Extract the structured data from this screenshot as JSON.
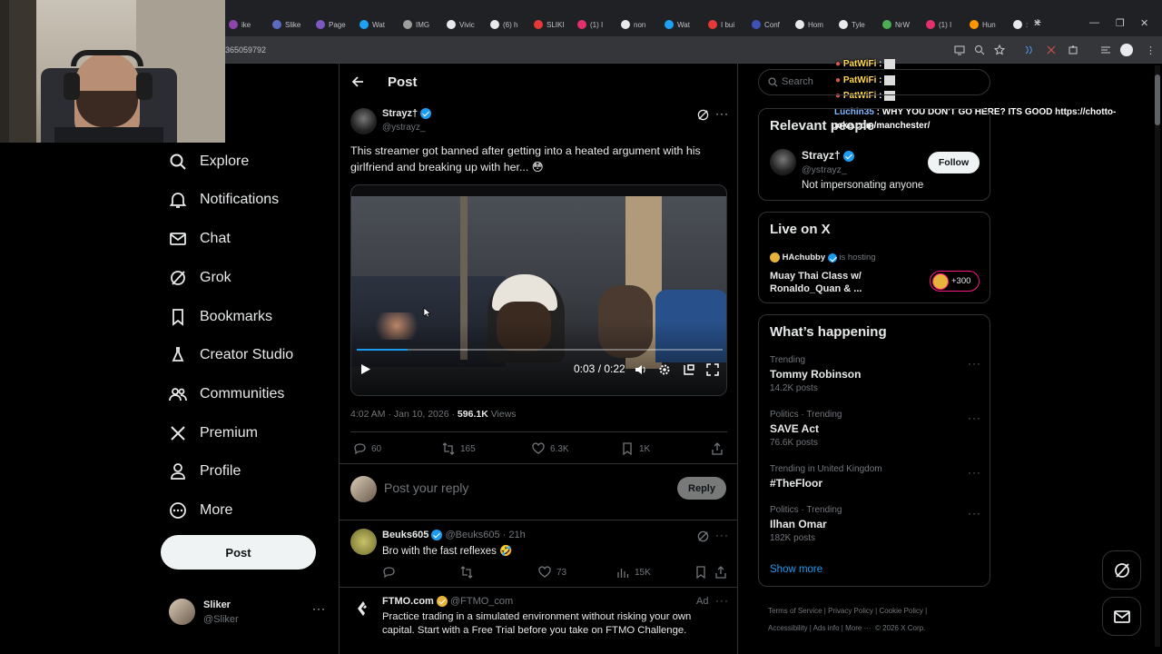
{
  "browser": {
    "tabs": [
      "ike",
      "Slike",
      "Page",
      "Wat",
      "IMG",
      "Vivic",
      "(6) h",
      "SLIKI",
      "(1) I",
      "non",
      "Wat",
      "I bui",
      "Conf",
      "Hom",
      "Tyle",
      "NrW",
      "(1) I",
      "Hun",
      ":"
    ],
    "url": "365059792"
  },
  "nav": {
    "items": [
      {
        "label": "me",
        "icon": "home-icon"
      },
      {
        "label": "Explore",
        "icon": "search-icon"
      },
      {
        "label": "Notifications",
        "icon": "bell-icon"
      },
      {
        "label": "Chat",
        "icon": "mail-icon"
      },
      {
        "label": "Grok",
        "icon": "grok-icon"
      },
      {
        "label": "Bookmarks",
        "icon": "bookmark-icon"
      },
      {
        "label": "Creator Studio",
        "icon": "flask-icon"
      },
      {
        "label": "Communities",
        "icon": "people-icon"
      },
      {
        "label": "Premium",
        "icon": "x-logo-icon"
      },
      {
        "label": "Profile",
        "icon": "person-icon"
      },
      {
        "label": "More",
        "icon": "more-circle-icon"
      }
    ],
    "post_button": "Post",
    "account": {
      "name": "Sliker",
      "handle": "@Sliker"
    }
  },
  "header": {
    "title": "Post"
  },
  "post": {
    "author": "Strayz†",
    "handle": "@ystrayz_",
    "text": "This streamer got banned after getting into a heated argument with his girlfriend and breaking up with her... 😳",
    "video_time": "0:03 / 0:22",
    "video_progress": 0.14,
    "timestamp": "4:02 AM · Jan 10, 2026 ·",
    "views_count": "596.1K",
    "views_label": "Views",
    "replies": "60",
    "reposts": "165",
    "likes": "6.3K",
    "bookmarks": "1K"
  },
  "reply_box": {
    "placeholder": "Post your reply",
    "button": "Reply"
  },
  "replies": [
    {
      "name": "Beuks605",
      "handle": "@Beuks605 · 21h",
      "text": "Bro with the fast reflexes 🤣",
      "likes": "73",
      "views": "15K"
    }
  ],
  "ad": {
    "name": "FTMO.com",
    "handle": "@FTMO_com",
    "label": "Ad",
    "text": "Practice trading in a simulated environment without risking your own capital. Start with a Free Trial before you take on FTMO Challenge."
  },
  "sidebar": {
    "search_placeholder": "Search",
    "relevant": {
      "title": "Relevant people",
      "name": "Strayz†",
      "handle": "@ystrayz_",
      "bio": "Not impersonating anyone",
      "follow": "Follow"
    },
    "live": {
      "title": "Live on X",
      "host": "HAchubby",
      "hosting": "is hosting",
      "space": "Muay Thai Class w/ Ronaldo_Quan & ...",
      "listeners": "+300"
    },
    "happening": {
      "title": "What’s happening",
      "trends": [
        {
          "category": "Trending",
          "name": "Tommy Robinson",
          "count": "14.2K posts"
        },
        {
          "category": "Politics · Trending",
          "name": "SAVE Act",
          "count": "76.6K posts"
        },
        {
          "category": "Trending in United Kingdom",
          "name": "#TheFloor",
          "count": ""
        },
        {
          "category": "Politics · Trending",
          "name": "Ilhan Omar",
          "count": "182K posts"
        }
      ],
      "show_more": "Show more"
    },
    "footer": [
      "Terms of Service",
      "Privacy Policy",
      "Cookie Policy",
      "Accessibility",
      "Ads info",
      "More ···",
      "© 2026 X Corp."
    ]
  },
  "chat_overlay": [
    {
      "user": "PatWiFi",
      "text": " :"
    },
    {
      "user": "PatWiFi",
      "text": " :"
    },
    {
      "user": "PatWiFi",
      "text": " :"
    },
    {
      "user": "Luchin35",
      "text": " : WHY YOU DON'T GO HERE? ITS GOOD https://chotto-"
    },
    {
      "user": "",
      "text": "poke.com/manchester/"
    }
  ],
  "colors": {
    "accent": "#1d9bf0",
    "background": "#000000",
    "border": "#2f3336",
    "muted": "#71767b",
    "like_pink": "#f91880"
  }
}
